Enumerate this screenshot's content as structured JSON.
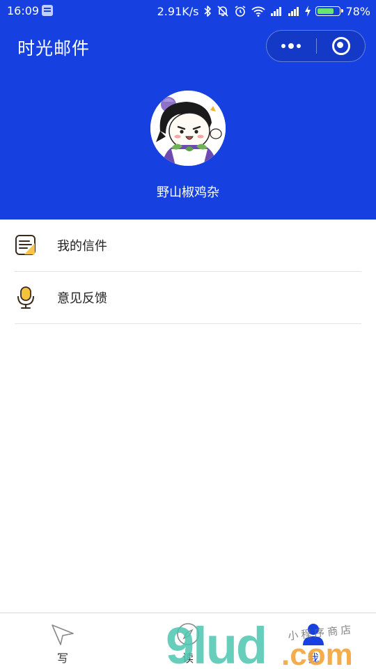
{
  "status_bar": {
    "time": "16:09",
    "speed": "2.91K/s",
    "battery_percent": "78%",
    "battery_level": 0.78,
    "icons": [
      "notification-icon",
      "bluetooth-icon",
      "mute-icon",
      "alarm-icon",
      "wifi-icon",
      "signal-icon",
      "signal-icon",
      "charging-icon",
      "battery-icon"
    ]
  },
  "header": {
    "title": "时光邮件",
    "username": "野山椒鸡杂",
    "capsule": {
      "more_icon": "more-dots-icon",
      "close_icon": "target-close-icon"
    }
  },
  "menu": {
    "items": [
      {
        "label": "我的信件",
        "icon": "letter-note-icon"
      },
      {
        "label": "意见反馈",
        "icon": "microphone-icon"
      }
    ]
  },
  "tabbar": {
    "tabs": [
      {
        "label": "写",
        "icon": "paper-plane-icon",
        "active": false
      },
      {
        "label": "读",
        "icon": "compass-icon",
        "active": false
      },
      {
        "label": "我",
        "icon": "person-icon",
        "active": true
      }
    ]
  },
  "watermark": {
    "brand": "9lud",
    "domain": ".com",
    "tagline": "小程序商店"
  },
  "colors": {
    "brand_blue": "#1641e0",
    "note_yellow": "#f8c44a",
    "mic_yellow": "#f5c33b",
    "divider": "#e3e3e3",
    "watermark_teal": "#4ec6b0",
    "watermark_orange": "#f2a43a"
  }
}
